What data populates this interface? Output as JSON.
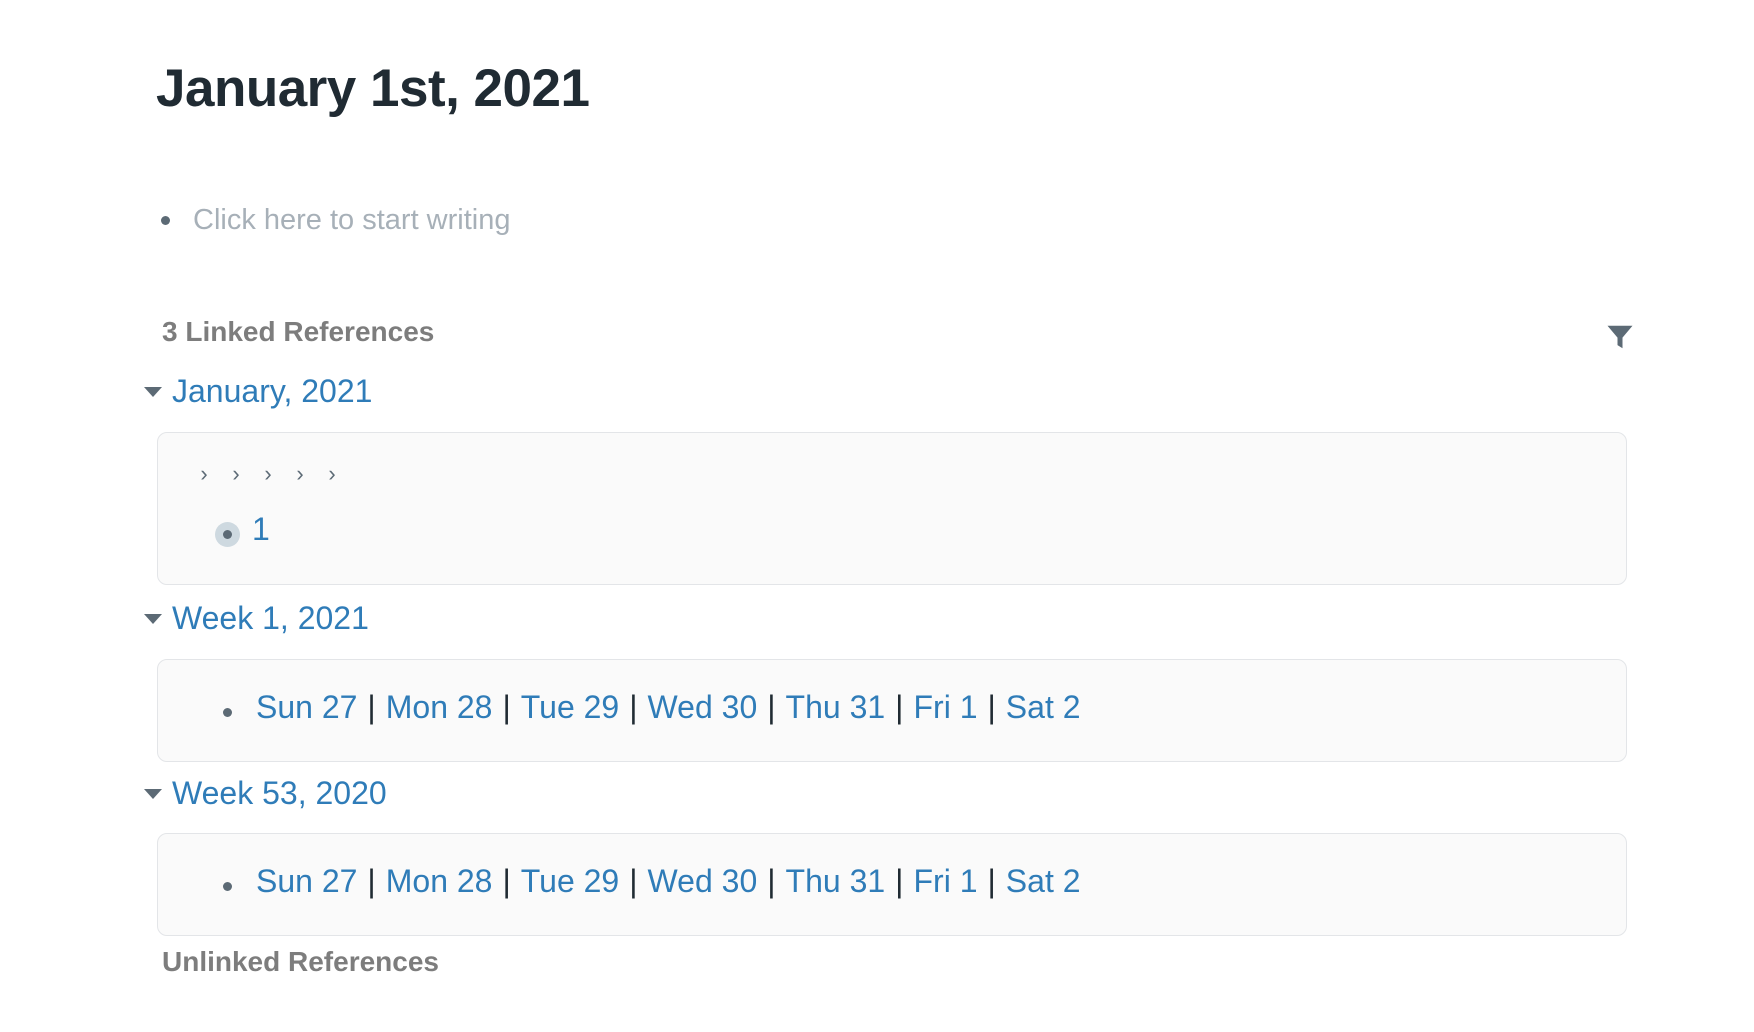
{
  "page": {
    "title": "January 1st, 2021",
    "placeholder": "Click here to start writing"
  },
  "linked_refs": {
    "header": "3 Linked References",
    "filter_icon": "filter-icon",
    "groups": [
      {
        "title": "January, 2021",
        "breadcrumbs": [
          "›",
          "›",
          "›",
          "›",
          "›"
        ],
        "block_text": "1"
      },
      {
        "title": "Week 1, 2021",
        "days": [
          "Sun 27",
          "Mon 28",
          "Tue 29",
          "Wed 30",
          "Thu 31",
          "Fri 1",
          "Sat 2"
        ],
        "separator": "|"
      },
      {
        "title": "Week 53, 2020",
        "days": [
          "Sun 27",
          "Mon 28",
          "Tue 29",
          "Wed 30",
          "Thu 31",
          "Fri 1",
          "Sat 2"
        ],
        "separator": "|"
      }
    ]
  },
  "unlinked_refs": {
    "header": "Unlinked References"
  },
  "colors": {
    "link": "#2f7cb8",
    "title": "#202b33",
    "muted": "#7d7d7d",
    "placeholder": "#a7b0b8"
  }
}
